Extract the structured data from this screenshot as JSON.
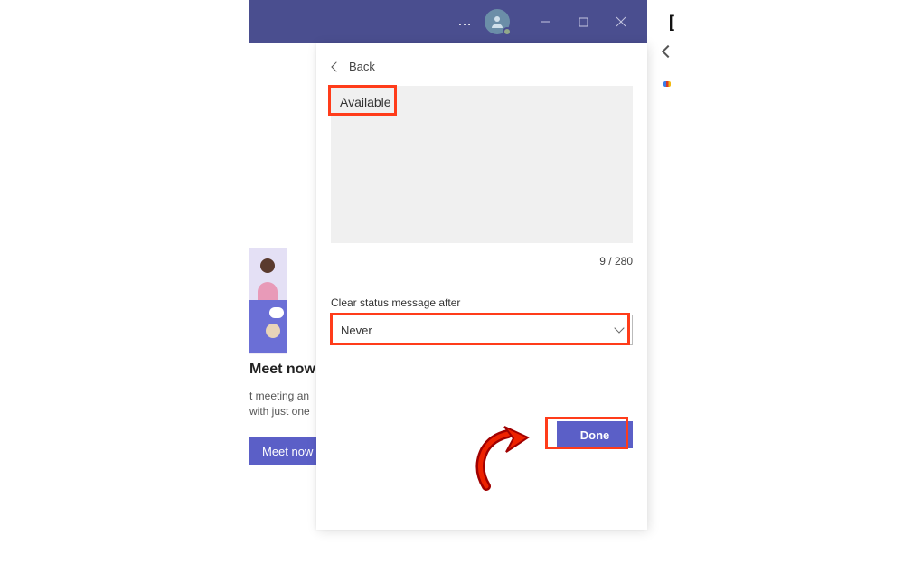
{
  "titlebar": {
    "more": "…"
  },
  "panel": {
    "back_label": "Back",
    "status_text": "Available",
    "char_count": "9 / 280",
    "clear_after_label": "Clear status message after",
    "clear_after_value": "Never",
    "done_label": "Done"
  },
  "meet": {
    "title": "Meet now",
    "desc_line1": "t meeting an",
    "desc_line2": "with just one",
    "button": "Meet now"
  }
}
